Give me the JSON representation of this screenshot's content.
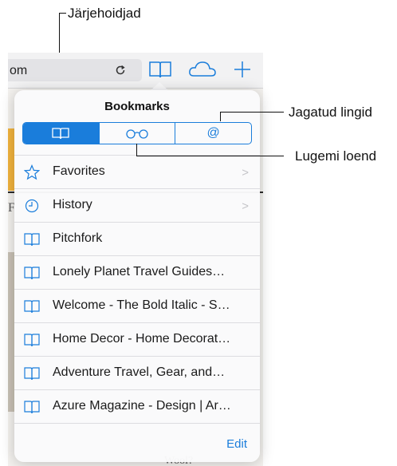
{
  "browser": {
    "url_text": "om",
    "faded_letter_1": "F",
    "faded_text_bottom": "Wool?"
  },
  "popover": {
    "title": "Bookmarks",
    "segments": [
      {
        "icon": "book-icon"
      },
      {
        "icon": "glasses-icon"
      },
      {
        "label": "@"
      }
    ],
    "items": [
      {
        "label": "Favorites",
        "icon": "star-icon",
        "chevron": true
      },
      {
        "label": "History",
        "icon": "clock-icon",
        "chevron": true
      },
      {
        "label": "Pitchfork",
        "icon": "book-icon"
      },
      {
        "label": "Lonely Planet Travel Guides…",
        "icon": "book-icon"
      },
      {
        "label": "Welcome - The Bold Italic - S…",
        "icon": "book-icon"
      },
      {
        "label": "Home Decor - Home Decorat…",
        "icon": "book-icon"
      },
      {
        "label": "Adventure Travel, Gear, and…",
        "icon": "book-icon"
      },
      {
        "label": "Azure Magazine - Design | Ar…",
        "icon": "book-icon"
      }
    ],
    "edit_label": "Edit"
  },
  "callouts": {
    "bookmarks": "Järjehoidjad",
    "shared_links": "Jagatud lingid",
    "reading_list": "Lugemi loend"
  },
  "colors": {
    "accent": "#1a7ddb"
  }
}
